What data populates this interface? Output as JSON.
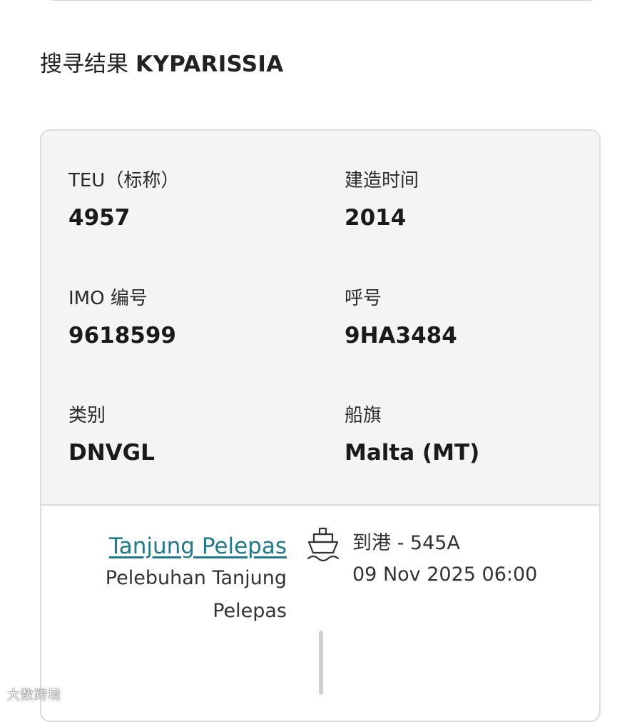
{
  "header": {
    "title_prefix": "搜寻结果",
    "vessel_name": "KYPARISSIA"
  },
  "vessel_info": {
    "teu_label": "TEU（标称）",
    "teu_value": "4957",
    "built_label": "建造时间",
    "built_value": "2014",
    "imo_label": "IMO 编号",
    "imo_value": "9618599",
    "callsign_label": "呼号",
    "callsign_value": "9HA3484",
    "class_label": "类别",
    "class_value": "DNVGL",
    "flag_label": "船旗",
    "flag_value": "Malta (MT)"
  },
  "schedule": {
    "port_name": "Tanjung Pelepas",
    "port_full_name": "Pelebuhan Tanjung Pelepas",
    "arrival_label": "到港 - 545A",
    "arrival_datetime": "09 Nov 2025 06:00",
    "icon": "ship-icon"
  },
  "watermark": {
    "text": "大数跨境"
  }
}
